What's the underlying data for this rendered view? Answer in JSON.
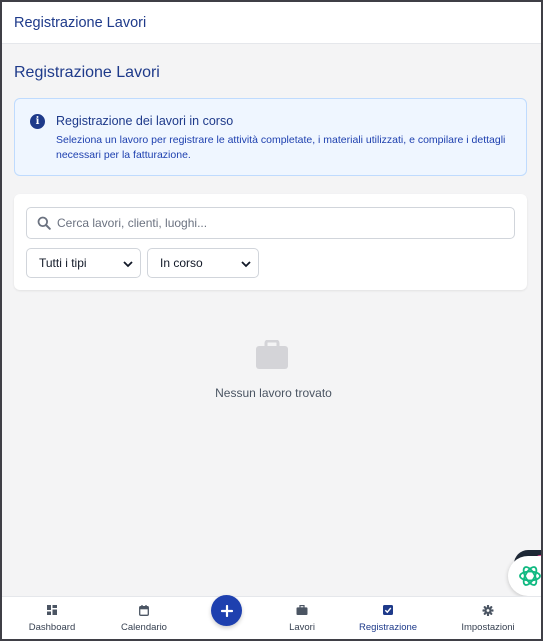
{
  "header": {
    "title": "Registrazione Lavori"
  },
  "page": {
    "title": "Registrazione Lavori"
  },
  "info": {
    "icon": "info-icon",
    "title": "Registrazione dei lavori in corso",
    "text": "Seleziona un lavoro per registrare le attività completate, i materiali utilizzati, e compilare i dettagli necessari per la fatturazione."
  },
  "filters": {
    "search_placeholder": "Cerca lavori, clienti, luoghi...",
    "type_selected": "Tutti i tipi",
    "status_selected": "In corso"
  },
  "empty": {
    "icon": "briefcase-icon",
    "text": "Nessun lavoro trovato"
  },
  "nav": {
    "items": [
      {
        "label": "Dashboard",
        "icon": "grid-icon"
      },
      {
        "label": "Calendario",
        "icon": "calendar-icon"
      },
      {
        "label": "Lavori",
        "icon": "briefcase-icon"
      },
      {
        "label": "Registrazione",
        "icon": "check-square-icon",
        "active": true
      },
      {
        "label": "Impostazioni",
        "icon": "gear-icon"
      }
    ],
    "add_icon": "plus-icon"
  },
  "colors": {
    "primary": "#1e40af",
    "info_bg": "#eff6ff",
    "assistant": "#10b981"
  }
}
